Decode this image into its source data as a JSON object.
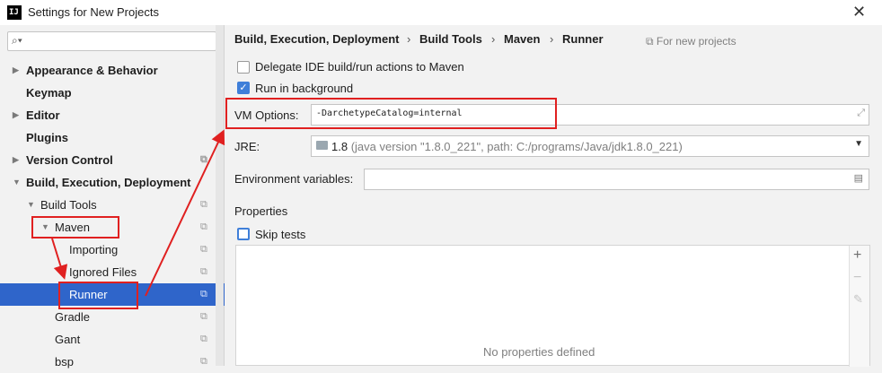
{
  "window": {
    "title": "Settings for New Projects",
    "app_icon": "IJ"
  },
  "sidebar": {
    "search_placeholder": "",
    "items": [
      {
        "label": "Appearance & Behavior",
        "arrow": "▶",
        "bold": true
      },
      {
        "label": "Keymap",
        "bold": true
      },
      {
        "label": "Editor",
        "arrow": "▶",
        "bold": true
      },
      {
        "label": "Plugins",
        "bold": true
      },
      {
        "label": "Version Control",
        "arrow": "▶",
        "bold": true
      },
      {
        "label": "Build, Execution, Deployment",
        "arrow": "▼",
        "bold": true
      },
      {
        "label": "Build Tools",
        "arrow": "▼"
      },
      {
        "label": "Maven",
        "arrow": "▼"
      },
      {
        "label": "Importing"
      },
      {
        "label": "Ignored Files"
      },
      {
        "label": "Runner",
        "selected": true
      },
      {
        "label": "Gradle"
      },
      {
        "label": "Gant"
      },
      {
        "label": "bsp"
      }
    ]
  },
  "breadcrumb": {
    "items": [
      "Build, Execution, Deployment",
      "Build Tools",
      "Maven",
      "Runner"
    ],
    "separator": "›",
    "scope_note": "For new projects"
  },
  "runner": {
    "delegate_label": "Delegate IDE build/run actions to Maven",
    "delegate_checked": false,
    "background_label": "Run in background",
    "background_checked": true,
    "vm_options_label": "VM Options:",
    "vm_options_value": "-DarchetypeCatalog=internal",
    "jre_label": "JRE:",
    "jre_version": "1.8",
    "jre_detail": "(java version \"1.8.0_221\", path: C:/programs/Java/jdk1.8.0_221)",
    "env_label": "Environment variables:",
    "env_value": "",
    "properties_label": "Properties",
    "skip_tests_label": "Skip tests",
    "skip_tests_checked": false,
    "empty_properties": "No properties defined"
  },
  "colors": {
    "selection": "#2f65ca",
    "annotation": "#e02020",
    "check": "#3f7fd9"
  }
}
